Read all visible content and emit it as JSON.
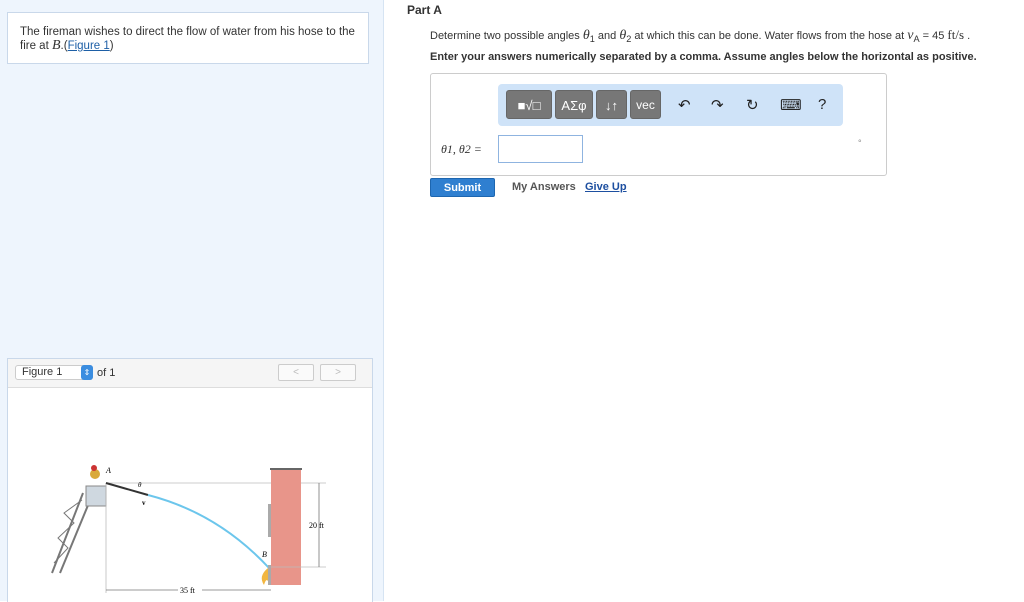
{
  "problem": {
    "text": "The fireman wishes to direct the flow of water from his hose to the fire at ",
    "point": "B",
    "punct": ".",
    "figure_link": "Figure 1",
    "close": ")",
    "open": "("
  },
  "figure": {
    "selector": "Figure 1",
    "of": "of 1",
    "prev": "<",
    "next": ">",
    "labels": {
      "a": "A",
      "b": "B",
      "theta": "θ",
      "va": "v",
      "va_sub": "A",
      "height": "20 ft",
      "distance": "35 ft"
    }
  },
  "part": {
    "title": "Part A",
    "question": {
      "t1": "Determine two possible angles ",
      "th1": "θ",
      "s1": "1",
      "t2": " and ",
      "th2": "θ",
      "s2": "2",
      "t3": " at which this can be done. Water flows from the hose at ",
      "v": "v",
      "vs": "A",
      "t4": " = 45 ",
      "unit": "ft/s",
      "t5": " ."
    },
    "instruction": "Enter your answers numerically separated by a comma. Assume angles below the horizontal as positive.",
    "toolbar": {
      "templates": "■√□",
      "greek": "ΑΣφ",
      "arrows": "↓↑",
      "vec": "vec",
      "undo": "↶",
      "redo": "↷",
      "reset": "↻",
      "keyboard": "⌨",
      "help": "?"
    },
    "answer_label": "θ1, θ2 =",
    "answer_value": "",
    "unit_symbol": "°"
  },
  "actions": {
    "submit": "Submit",
    "my_answers": "My Answers",
    "give_up": "Give Up"
  }
}
